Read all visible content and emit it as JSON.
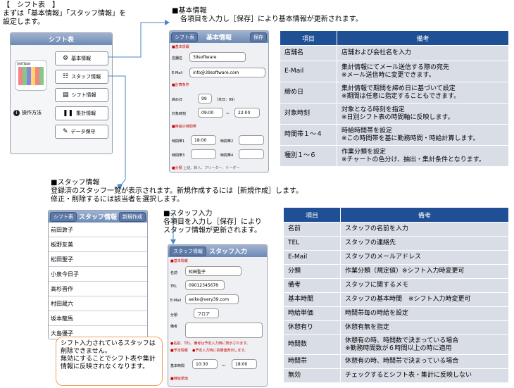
{
  "intro": [
    "【　シフト表　】",
    "まずは「基本情報」「スタッフ情報」を",
    "設定します。"
  ],
  "main_phone": {
    "title": "シフト表",
    "app_icon_label": "ShiftTable",
    "menu": [
      {
        "label": "基本情報",
        "icon": "gear-icon"
      },
      {
        "label": "スタッフ情報",
        "icon": "staff-icon"
      },
      {
        "label": "シフト情報",
        "icon": "document-icon"
      },
      {
        "label": "集計情報",
        "icon": "book-icon"
      },
      {
        "label": "データ保守",
        "icon": "wrench-icon"
      }
    ],
    "help": "操作方法"
  },
  "basic": {
    "heading": "■基本情報",
    "desc": "各項目を入力し［保存］により基本情報が更新されます。",
    "phone": {
      "back": "シフト表",
      "title": "基本情報",
      "save": "保存",
      "sec1": "■基本情報",
      "store_label": "店舗名",
      "store_value": "39software",
      "mail_label": "E-Mail",
      "mail_value": "info@39software.com",
      "sec2": "■計算条件",
      "close_label": "締め日",
      "close_value": "99",
      "close_note": "（末日：99）",
      "time_label": "対象時刻",
      "time_from": "09:00",
      "tilde": "〜",
      "time_to": "22:00",
      "sec3": "■時給の時間帯",
      "slot1": "時間帯1",
      "slot1_value": "18:00",
      "slot2": "時間帯2",
      "slot3": "時間帯3",
      "slot4": "時間帯4",
      "sec4": "■分類",
      "sec4_note": "上班、新人、フリーター、リーダー"
    },
    "table": {
      "headers": [
        "項目",
        "備考"
      ],
      "rows": [
        [
          "店舗名",
          "店舗および会社名を入力"
        ],
        [
          "E-Mail",
          "集計情報にてメール送信する際の宛先\n※メール送信時に変更できます。"
        ],
        [
          "締め日",
          "集計情報で期間を締め日に基づいて設定\n※期間は任意に指定することもできます。"
        ],
        [
          "対象時刻",
          "対象となる時刻を指定\n※日別シフト表の時間軸に反映します。"
        ],
        [
          "時間帯１〜４",
          "時給時間帯を設定\n※この時間帯を基に勤務時間・時給計算します。"
        ],
        [
          "種別１〜６",
          "作業分類を設定\n※チャートの色分け、抽出・集計条件となります。"
        ]
      ]
    }
  },
  "staff": {
    "heading": "■スタッフ情報",
    "desc1": "登録済のスタッフ一覧が表示されます。新規作成するには［新規作成］します。",
    "desc2": "修正・削除するには該当者を選択します。",
    "phone": {
      "back": "シフト表",
      "title": "スタッフ情報",
      "new": "新規作成",
      "names": [
        "前田敦子",
        "板野友美",
        "松田聖子",
        "小泉今日子",
        "高杉晋作",
        "村田蔵六",
        "坂本龍馬",
        "大島優子"
      ]
    },
    "callout": "シフト入力されているスタッフは削除できません。\n無効にすることでシフト表や集計情報に反映されなくなります。"
  },
  "staff_input": {
    "heading": "■スタッフ入力",
    "desc": "各項目を入力し［保存］により\nスタッフ情報が更新されます。",
    "phone": {
      "back": "スタッフ情報",
      "title": "スタッフ入力",
      "sec1": "■基本情報",
      "name_label": "名前",
      "name_value": "松田聖子",
      "tel_label": "TEL",
      "tel_value": "09012345678",
      "mail_label": "E-Mail",
      "mail_value": "seiko@very39.com",
      "cat_label": "分類",
      "cat_value": "フロア",
      "memo_label": "備考",
      "note": "●名前、TEL、備考は予定入力時に表示されます。",
      "sec2": "■予定情報",
      "sec2_note": "●予定入力時に初期値表示します。",
      "base_label": "基本時間",
      "base_from": "10:30",
      "tilde": "〜",
      "base_to": "18:00",
      "sec3": "■時給単価"
    },
    "table": {
      "headers": [
        "項目",
        "備考"
      ],
      "rows": [
        [
          "名前",
          "スタッフの名前を入力"
        ],
        [
          "TEL",
          "スタッフの連絡先"
        ],
        [
          "E-Mail",
          "スタッフのメールアドレス"
        ],
        [
          "分類",
          "作業分類（規定値）※シフト入力時変更可"
        ],
        [
          "備考",
          "スタッフに関するメモ"
        ],
        [
          "基本時間",
          "スタッフの基本時間　※シフト入力時変更可"
        ],
        [
          "時給単価",
          "時間帯毎の時給を設定"
        ],
        [
          "休憩有り",
          "休憩有無を指定"
        ],
        [
          "時間数",
          "休憩有の時、時間数で決まっている場合\n※勤務時間数が６時間以上の時に適用"
        ],
        [
          "時間帯",
          "休憩有の時、時間帯で決まっている場合"
        ],
        [
          "無効",
          "チェックするとシフト表・集計に反映しない"
        ]
      ]
    }
  },
  "colors": {
    "table_header": "#1f4f94",
    "table_cell": "#d8dde6",
    "arrow": "#4a86c8",
    "callout_border": "#f0a060"
  }
}
